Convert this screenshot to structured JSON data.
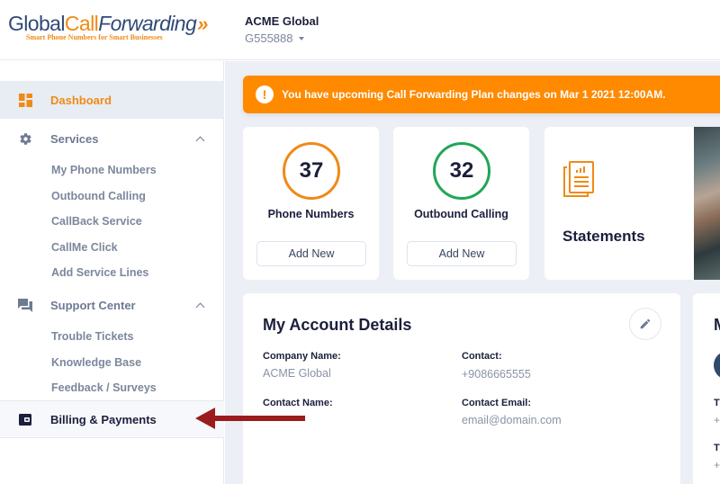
{
  "brand": {
    "logo_part1": "Global",
    "logo_part2": "Call",
    "logo_part3": "Forwarding",
    "logo_chevrons": "»",
    "tagline": "Smart Phone Numbers for Smart Businesses",
    "accent_color": "#f08a16",
    "primary_color": "#2f4a78"
  },
  "account_switcher": {
    "name": "ACME Global",
    "id": "G555888"
  },
  "sidebar": {
    "dashboard": "Dashboard",
    "services": {
      "label": "Services",
      "items": [
        "My Phone Numbers",
        "Outbound Calling",
        "CallBack Service",
        "CallMe Click",
        "Add Service Lines"
      ]
    },
    "support": {
      "label": "Support Center",
      "items": [
        "Trouble Tickets",
        "Knowledge Base",
        "Feedback / Surveys"
      ]
    },
    "billing": "Billing & Payments"
  },
  "alert": {
    "icon": "exclamation-icon",
    "text": "You have upcoming Call Forwarding Plan changes on Mar 1 2021 12:00AM."
  },
  "stats": [
    {
      "value": "37",
      "label": "Phone Numbers",
      "button": "Add New",
      "color": "#f08a16"
    },
    {
      "value": "32",
      "label": "Outbound Calling",
      "button": "Add New",
      "color": "#22a657"
    }
  ],
  "statements": {
    "label": "Statements"
  },
  "account_details": {
    "title": "My Account Details",
    "fields": [
      {
        "label": "Company Name:",
        "value": "ACME Global"
      },
      {
        "label": "Contact:",
        "value": "+9086665555"
      },
      {
        "label": "Contact Name:",
        "value": ""
      },
      {
        "label": "Contact Email:",
        "value": "email@domain.com"
      }
    ]
  },
  "right_card": {
    "title_partial": "M",
    "label_1_partial": "T",
    "value_1_partial": "+",
    "label_2_partial": "T",
    "value_2_partial": "+"
  },
  "annotation": {
    "arrow_color": "#9b1c1c"
  }
}
